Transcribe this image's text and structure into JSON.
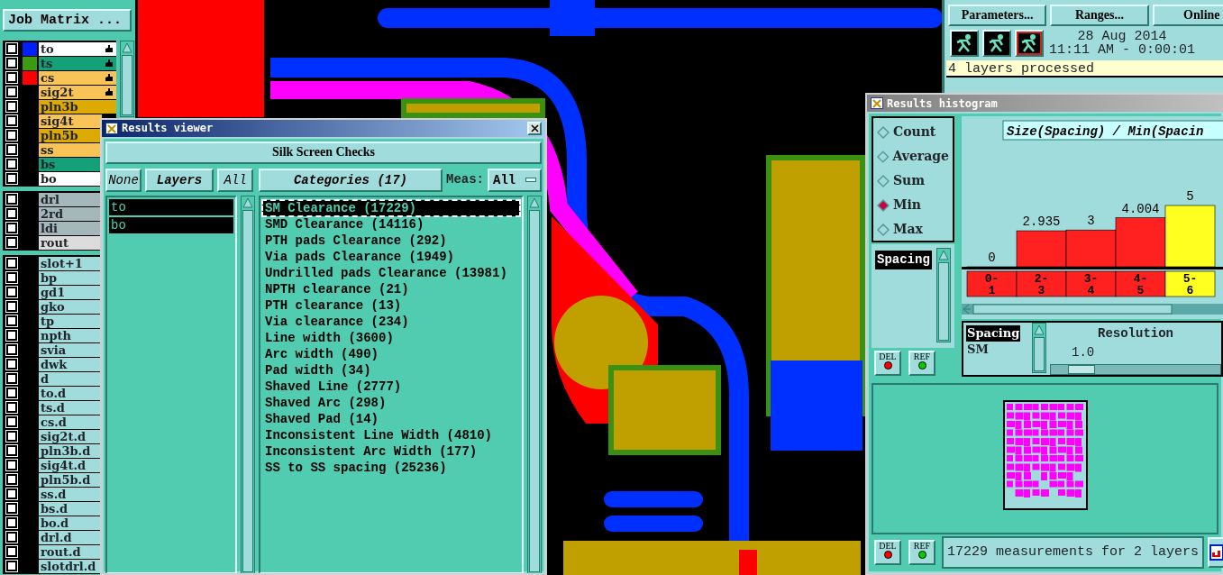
{
  "layer_panel": {
    "job_button": "Job Matrix ...",
    "groups": [
      [
        {
          "name": "to",
          "color": "#ffffff",
          "swatch": {
            "color": "#0020ff"
          },
          "marked": true,
          "checked": false
        },
        {
          "name": "ts",
          "color": "#14a078",
          "swatch": {
            "color": "#3c9a10"
          },
          "marked": true,
          "checked": false
        },
        {
          "name": "cs",
          "color": "#f8c458",
          "swatch": {
            "color": "#ff0000"
          },
          "marked": true,
          "checked": false
        },
        {
          "name": "sig2t",
          "color": "#f8c458",
          "marked": true,
          "checked": false
        },
        {
          "name": "pln3b",
          "color": "#dcaa00",
          "marked": false,
          "checked": false
        },
        {
          "name": "sig4t",
          "color": "#f8c458",
          "marked": false,
          "checked": false
        },
        {
          "name": "pln5b",
          "color": "#dcaa00",
          "marked": false,
          "checked": false
        },
        {
          "name": "ss",
          "color": "#f8c458",
          "marked": false,
          "checked": false
        },
        {
          "name": "bs",
          "color": "#14a078",
          "marked": false,
          "checked": false
        },
        {
          "name": "bo",
          "color": "#ffffff",
          "marked": false,
          "checked": false
        }
      ],
      [
        {
          "name": "drl",
          "color": "#a4b8bc",
          "marked": false,
          "checked": false
        },
        {
          "name": "2rd",
          "color": "#a4b8bc",
          "marked": false,
          "checked": false
        },
        {
          "name": "ldi",
          "color": "#a4b8bc",
          "marked": false,
          "checked": false
        },
        {
          "name": "rout",
          "color": "#dcdcdc",
          "marked": false,
          "checked": false
        }
      ],
      [
        {
          "name": "slot+1",
          "color": "#a0dcdc",
          "marked": false,
          "checked": false
        },
        {
          "name": "bp",
          "color": "#a0dcdc",
          "marked": false,
          "checked": false
        },
        {
          "name": "gd1",
          "color": "#a0dcdc",
          "marked": false,
          "checked": false
        },
        {
          "name": "gko",
          "color": "#a0dcdc",
          "marked": false,
          "checked": false
        },
        {
          "name": "tp",
          "color": "#a0dcdc",
          "marked": false,
          "checked": false
        },
        {
          "name": "npth",
          "color": "#a0dcdc",
          "marked": false,
          "checked": false
        },
        {
          "name": "svia",
          "color": "#a0dcdc",
          "marked": false,
          "checked": false
        },
        {
          "name": "dwk",
          "color": "#a0dcdc",
          "marked": false,
          "checked": false
        },
        {
          "name": "d",
          "color": "#a0dcdc",
          "marked": false,
          "checked": false
        },
        {
          "name": "to.d",
          "color": "#a0dcdc",
          "marked": false,
          "checked": false
        },
        {
          "name": "ts.d",
          "color": "#a0dcdc",
          "marked": false,
          "checked": false
        },
        {
          "name": "cs.d",
          "color": "#a0dcdc",
          "marked": false,
          "checked": false
        },
        {
          "name": "sig2t.d",
          "color": "#a0dcdc",
          "marked": false,
          "checked": false
        },
        {
          "name": "pln3b.d",
          "color": "#a0dcdc",
          "marked": false,
          "checked": false
        },
        {
          "name": "sig4t.d",
          "color": "#a0dcdc",
          "marked": false,
          "checked": false
        },
        {
          "name": "pln5b.d",
          "color": "#a0dcdc",
          "marked": false,
          "checked": false
        },
        {
          "name": "ss.d",
          "color": "#a0dcdc",
          "marked": false,
          "checked": false
        },
        {
          "name": "bs.d",
          "color": "#a0dcdc",
          "marked": false,
          "checked": false
        },
        {
          "name": "bo.d",
          "color": "#a0dcdc",
          "marked": false,
          "checked": false
        },
        {
          "name": "drl.d",
          "color": "#a0dcdc",
          "marked": false,
          "checked": false
        },
        {
          "name": "rout.d",
          "color": "#a0dcdc",
          "marked": false,
          "checked": false
        },
        {
          "name": "slotdrl.d",
          "color": "#a0dcdc",
          "marked": false,
          "checked": false
        }
      ]
    ]
  },
  "control_panel": {
    "buttons": [
      "Parameters...",
      "Ranges...",
      "Online"
    ],
    "date": "28 Aug 2014",
    "time": "11:11 AM - 0:00:01",
    "status": "4 layers processed"
  },
  "results_viewer": {
    "title": "Results viewer",
    "checks_button": "Silk Screen Checks",
    "layer_buttons": [
      "None",
      "Layers",
      "All"
    ],
    "categories_button": "Categories (17)",
    "meas_label": "Meas:",
    "meas_value": "All",
    "layers": [
      {
        "name": "to",
        "selected": true
      },
      {
        "name": "bo",
        "selected": true
      }
    ],
    "categories": [
      {
        "label": "SM Clearance (17229)",
        "selected": true
      },
      {
        "label": "SMD Clearance (14116)",
        "selected": false
      },
      {
        "label": "PTH pads Clearance (292)",
        "selected": false
      },
      {
        "label": "Via pads Clearance (1949)",
        "selected": false
      },
      {
        "label": "Undrilled pads Clearance (13981)",
        "selected": false
      },
      {
        "label": "NPTH clearance (21)",
        "selected": false
      },
      {
        "label": "PTH clearance (13)",
        "selected": false
      },
      {
        "label": "Via clearance (234)",
        "selected": false
      },
      {
        "label": "Line width (3600)",
        "selected": false
      },
      {
        "label": "Arc width (490)",
        "selected": false
      },
      {
        "label": "Pad width (34)",
        "selected": false
      },
      {
        "label": "Shaved Line (2777)",
        "selected": false
      },
      {
        "label": "Shaved Arc (298)",
        "selected": false
      },
      {
        "label": "Shaved Pad (14)",
        "selected": false
      },
      {
        "label": "Inconsistent Line Width (4810)",
        "selected": false
      },
      {
        "label": "Inconsistent Arc Width (177)",
        "selected": false
      },
      {
        "label": "SS to SS spacing (25236)",
        "selected": false
      }
    ]
  },
  "histogram": {
    "title": "Results histogram",
    "modes": [
      {
        "label": "Count",
        "selected": false
      },
      {
        "label": "Average",
        "selected": false
      },
      {
        "label": "Sum",
        "selected": false
      },
      {
        "label": "Min",
        "selected": true
      },
      {
        "label": "Max",
        "selected": false
      }
    ],
    "attributes": [
      {
        "label": "Spacing",
        "selected": true
      }
    ],
    "side_buttons": [
      {
        "label": "DEL",
        "color": "#ff0000"
      },
      {
        "label": "REF",
        "color": "#00d000"
      }
    ],
    "chart_data": {
      "type": "bar",
      "title": "Size(Spacing) / Min(Spacin",
      "categories": [
        "0-\n1",
        "2-\n3",
        "3-\n4",
        "4-\n5",
        "5-\n6"
      ],
      "series": [
        {
          "values": [
            0,
            2.935,
            3,
            4.004,
            5
          ]
        }
      ],
      "data_labels": true
    },
    "bins": [
      {
        "color": "#ff2020"
      },
      {
        "color": "#ff2020"
      },
      {
        "color": "#ff2020"
      },
      {
        "color": "#ff2020"
      },
      {
        "color": "#ffff20"
      }
    ],
    "fields": [
      {
        "label": "Spacing",
        "selected": true
      },
      {
        "label": "SM",
        "selected": false
      }
    ],
    "resolution": {
      "label": "Resolution",
      "value": "1.0",
      "level": 0.1
    },
    "bottom_buttons": [
      {
        "label": "DEL",
        "color": "#ff0000"
      },
      {
        "label": "REF",
        "color": "#00d000"
      }
    ],
    "summary": "17229 measurements for 2 layers"
  }
}
